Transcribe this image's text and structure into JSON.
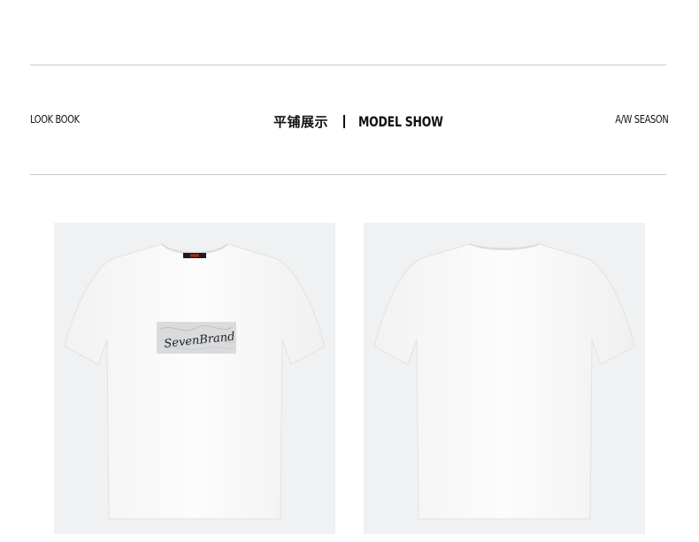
{
  "header": {
    "left_label": "LOOK BOOK",
    "center_cn": "平铺展示",
    "center_en": "MODEL SHOW",
    "right_label": "A/W SEASON"
  },
  "products": [
    {
      "view": "front",
      "print_text": "SevenBrand"
    },
    {
      "view": "back"
    }
  ],
  "colors": {
    "background": "#ffffff",
    "photo_background": "#eff1f3",
    "shirt": "#fafafa",
    "divider": "#c8c8c8"
  }
}
